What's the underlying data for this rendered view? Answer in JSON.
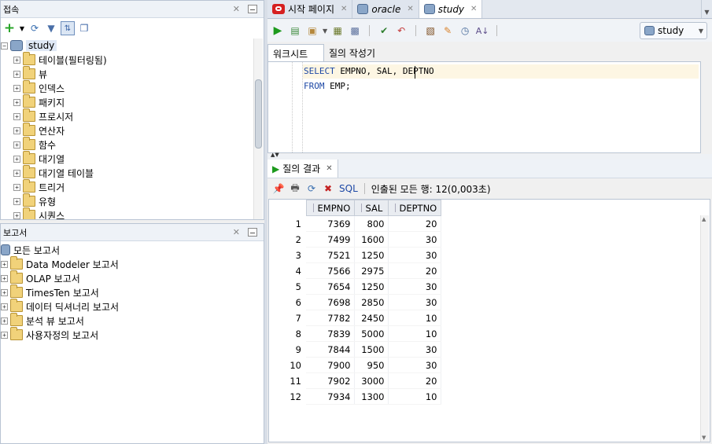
{
  "connections_panel": {
    "title": "접속",
    "tree": {
      "root": "study",
      "items": [
        "테이블(필터링됨)",
        "뷰",
        "인덱스",
        "패키지",
        "프로시저",
        "연산자",
        "함수",
        "대기열",
        "대기열 테이블",
        "트리거",
        "유형",
        "시퀀스"
      ]
    }
  },
  "reports_panel": {
    "title": "보고서",
    "root": "모든 보고서",
    "items": [
      "Data Modeler 보고서",
      "OLAP 보고서",
      "TimesTen 보고서",
      "데이터 딕셔너리 보고서",
      "분석 뷰 보고서",
      "사용자정의 보고서"
    ]
  },
  "tabs": [
    {
      "label": "시작 페이지",
      "active": false
    },
    {
      "label": "oracle",
      "active": false
    },
    {
      "label": "study",
      "active": true
    }
  ],
  "editor": {
    "connection": "study",
    "subtabs": [
      "워크시트",
      "질의 작성기"
    ],
    "lines": [
      "SELECT EMPNO, SAL, DEPTNO",
      "FROM EMP;"
    ]
  },
  "results": {
    "tab_label": "질의 결과",
    "sql_label": "SQL",
    "status": "인출된 모든 행: 12(0,003초)",
    "columns": [
      "EMPNO",
      "SAL",
      "DEPTNO"
    ],
    "rows": [
      [
        "1",
        "7369",
        "800",
        "20"
      ],
      [
        "2",
        "7499",
        "1600",
        "30"
      ],
      [
        "3",
        "7521",
        "1250",
        "30"
      ],
      [
        "4",
        "7566",
        "2975",
        "20"
      ],
      [
        "5",
        "7654",
        "1250",
        "30"
      ],
      [
        "6",
        "7698",
        "2850",
        "30"
      ],
      [
        "7",
        "7782",
        "2450",
        "10"
      ],
      [
        "8",
        "7839",
        "5000",
        "10"
      ],
      [
        "9",
        "7844",
        "1500",
        "30"
      ],
      [
        "10",
        "7900",
        "950",
        "30"
      ],
      [
        "11",
        "7902",
        "3000",
        "20"
      ],
      [
        "12",
        "7934",
        "1300",
        "10"
      ]
    ]
  }
}
